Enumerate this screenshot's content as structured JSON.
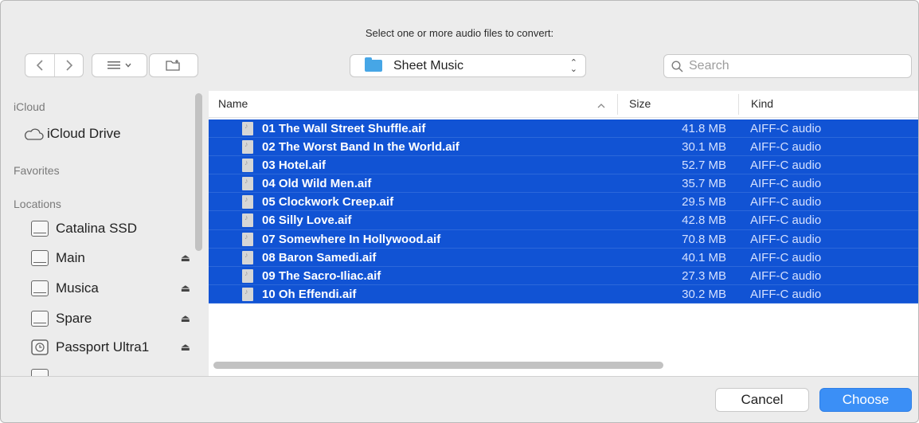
{
  "dialog": {
    "prompt": "Select one or more audio files to convert:"
  },
  "toolbar": {
    "location_name": "Sheet Music",
    "search_placeholder": "Search"
  },
  "sidebar": {
    "sections": [
      {
        "header": "iCloud",
        "items": [
          {
            "label": "iCloud Drive",
            "icon": "cloud-icon",
            "eject": false
          }
        ]
      },
      {
        "header": "Favorites",
        "items": []
      },
      {
        "header": "Locations",
        "items": [
          {
            "label": "Catalina SSD",
            "icon": "disk-icon",
            "eject": false
          },
          {
            "label": "Main",
            "icon": "disk-icon",
            "eject": true
          },
          {
            "label": "Musica",
            "icon": "disk-icon",
            "eject": true
          },
          {
            "label": "Spare",
            "icon": "disk-icon",
            "eject": true
          },
          {
            "label": "Passport Ultra1",
            "icon": "timemachine-disk-icon",
            "eject": true
          }
        ]
      }
    ]
  },
  "columns": {
    "name": "Name",
    "size": "Size",
    "kind": "Kind"
  },
  "files": [
    {
      "name": "01 The Wall Street Shuffle.aif",
      "size": "41.8 MB",
      "kind": "AIFF-C audio"
    },
    {
      "name": "02 The Worst Band In the World.aif",
      "size": "30.1 MB",
      "kind": "AIFF-C audio"
    },
    {
      "name": "03 Hotel.aif",
      "size": "52.7 MB",
      "kind": "AIFF-C audio"
    },
    {
      "name": "04 Old Wild Men.aif",
      "size": "35.7 MB",
      "kind": "AIFF-C audio"
    },
    {
      "name": "05 Clockwork Creep.aif",
      "size": "29.5 MB",
      "kind": "AIFF-C audio"
    },
    {
      "name": "06 Silly Love.aif",
      "size": "42.8 MB",
      "kind": "AIFF-C audio"
    },
    {
      "name": "07 Somewhere In Hollywood.aif",
      "size": "70.8 MB",
      "kind": "AIFF-C audio"
    },
    {
      "name": "08 Baron Samedi.aif",
      "size": "40.1 MB",
      "kind": "AIFF-C audio"
    },
    {
      "name": "09 The Sacro-Iliac.aif",
      "size": "27.3 MB",
      "kind": "AIFF-C audio"
    },
    {
      "name": "10 Oh Effendi.aif",
      "size": "30.2 MB",
      "kind": "AIFF-C audio"
    }
  ],
  "footer": {
    "cancel_label": "Cancel",
    "choose_label": "Choose"
  },
  "colors": {
    "selection": "#1153d4",
    "accent": "#3b8ff6"
  }
}
